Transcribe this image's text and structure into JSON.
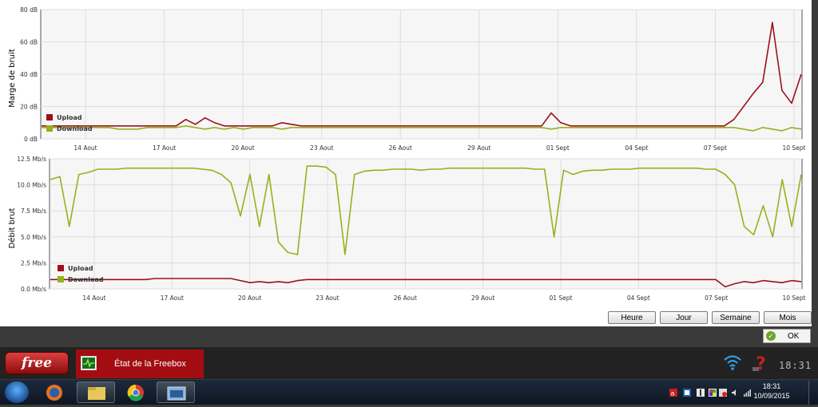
{
  "top_chart": {
    "ylabel": "Marge de bruit",
    "yticks": [
      "80 dB",
      "60 dB",
      "40 dB",
      "20 dB",
      "0 dB"
    ],
    "xticks": [
      "14 Aout",
      "17 Aout",
      "20 Aout",
      "23 Aout",
      "26 Aout",
      "29 Aout",
      "01 Sept",
      "04 Sept",
      "07 Sept",
      "10 Sept"
    ],
    "legend": [
      {
        "label": "Upload",
        "color": "#9d0f1c"
      },
      {
        "label": "Download",
        "color": "#97b11c"
      }
    ]
  },
  "bottom_chart": {
    "ylabel": "Débit brut",
    "yticks": [
      "12.5 Mb/s",
      "10.0 Mb/s",
      "7.5 Mb/s",
      "5.0 Mb/s",
      "2.5 Mb/s",
      "0.0 Mb/s"
    ],
    "xticks": [
      "14 Aout",
      "17 Aout",
      "20 Aout",
      "23 Aout",
      "26 Aout",
      "29 Aout",
      "01 Sept",
      "04 Sept",
      "07 Sept",
      "10 Sept"
    ],
    "legend": [
      {
        "label": "Upload",
        "color": "#9d0f1c"
      },
      {
        "label": "Download",
        "color": "#97b11c"
      }
    ]
  },
  "chart_data": [
    {
      "type": "line",
      "ylabel": "Marge de bruit",
      "ylim": [
        0,
        80
      ],
      "categories": [
        "14 Aout",
        "17 Aout",
        "20 Aout",
        "23 Aout",
        "26 Aout",
        "29 Aout",
        "01 Sept",
        "04 Sept",
        "07 Sept",
        "10 Sept"
      ],
      "series": [
        {
          "name": "Upload",
          "color": "#9d0f1c",
          "values": [
            8,
            8,
            8,
            8,
            8,
            8,
            8,
            8,
            8,
            8,
            8,
            8,
            8,
            8,
            8,
            12,
            9,
            13,
            10,
            8,
            8,
            8,
            8,
            8,
            8,
            10,
            9,
            8,
            8,
            8,
            8,
            8,
            8,
            8,
            8,
            8,
            8,
            8,
            8,
            8,
            8,
            8,
            8,
            8,
            8,
            8,
            8,
            8,
            8,
            8,
            8,
            8,
            8,
            16,
            10,
            8,
            8,
            8,
            8,
            8,
            8,
            8,
            8,
            8,
            8,
            8,
            8,
            8,
            8,
            8,
            8,
            8,
            12,
            20,
            28,
            35,
            72,
            30,
            22,
            40
          ]
        },
        {
          "name": "Download",
          "color": "#97b11c",
          "values": [
            7,
            7,
            7,
            7,
            7,
            7,
            7,
            7,
            6,
            6,
            6,
            7,
            7,
            7,
            7,
            8,
            7,
            6,
            7,
            6,
            7,
            6,
            7,
            7,
            7,
            6,
            7,
            7,
            7,
            7,
            7,
            7,
            7,
            7,
            7,
            7,
            7,
            7,
            7,
            7,
            7,
            7,
            7,
            7,
            7,
            7,
            7,
            7,
            7,
            7,
            7,
            7,
            7,
            6,
            7,
            7,
            7,
            7,
            7,
            7,
            7,
            7,
            7,
            7,
            7,
            7,
            7,
            7,
            7,
            7,
            7,
            7,
            7,
            6,
            5,
            7,
            6,
            5,
            7,
            6
          ]
        }
      ]
    },
    {
      "type": "line",
      "ylabel": "Débit brut",
      "ylim": [
        0,
        12.5
      ],
      "categories": [
        "14 Aout",
        "17 Aout",
        "20 Aout",
        "23 Aout",
        "26 Aout",
        "29 Aout",
        "01 Sept",
        "04 Sept",
        "07 Sept",
        "10 Sept"
      ],
      "series": [
        {
          "name": "Upload",
          "color": "#9d0f1c",
          "values": [
            0.9,
            0.9,
            0.9,
            0.9,
            0.9,
            0.9,
            0.9,
            0.9,
            0.9,
            0.9,
            0.9,
            1.0,
            1.0,
            1.0,
            1.0,
            1.0,
            1.0,
            1.0,
            1.0,
            1.0,
            0.8,
            0.6,
            0.7,
            0.6,
            0.7,
            0.6,
            0.8,
            0.9,
            0.9,
            0.9,
            0.9,
            0.9,
            0.9,
            0.9,
            0.9,
            0.9,
            0.9,
            0.9,
            0.9,
            0.9,
            0.9,
            0.9,
            0.9,
            0.9,
            0.9,
            0.9,
            0.9,
            0.9,
            0.9,
            0.9,
            0.9,
            0.9,
            0.9,
            0.9,
            0.9,
            0.9,
            0.9,
            0.9,
            0.9,
            0.9,
            0.9,
            0.9,
            0.9,
            0.9,
            0.9,
            0.9,
            0.9,
            0.9,
            0.9,
            0.9,
            0.9,
            0.2,
            0.5,
            0.7,
            0.6,
            0.8,
            0.7,
            0.6,
            0.8,
            0.7
          ]
        },
        {
          "name": "Download",
          "color": "#97b11c",
          "values": [
            10.5,
            10.8,
            6.0,
            11.0,
            11.2,
            11.5,
            11.5,
            11.5,
            11.6,
            11.6,
            11.6,
            11.6,
            11.6,
            11.6,
            11.6,
            11.6,
            11.5,
            11.4,
            11.0,
            10.2,
            7.0,
            11.0,
            6.0,
            11.0,
            4.5,
            3.5,
            3.3,
            11.8,
            11.8,
            11.7,
            11.0,
            3.3,
            11.0,
            11.3,
            11.4,
            11.4,
            11.5,
            11.5,
            11.5,
            11.4,
            11.5,
            11.5,
            11.6,
            11.6,
            11.6,
            11.6,
            11.6,
            11.6,
            11.6,
            11.6,
            11.6,
            11.5,
            11.5,
            5.0,
            11.4,
            11.0,
            11.3,
            11.4,
            11.4,
            11.5,
            11.5,
            11.5,
            11.6,
            11.6,
            11.6,
            11.6,
            11.6,
            11.6,
            11.6,
            11.5,
            11.5,
            11.0,
            10.0,
            6.0,
            5.2,
            8.0,
            5.0,
            10.5,
            6.0,
            11.0
          ]
        }
      ]
    }
  ],
  "range_buttons": [
    "Heure",
    "Jour",
    "Semaine",
    "Mois"
  ],
  "ok_label": "OK",
  "free_label": "free",
  "app_title": "État de la Freebox",
  "free_clock": "18:31",
  "tray": {
    "time": "18:31",
    "date": "10/09/2015"
  }
}
